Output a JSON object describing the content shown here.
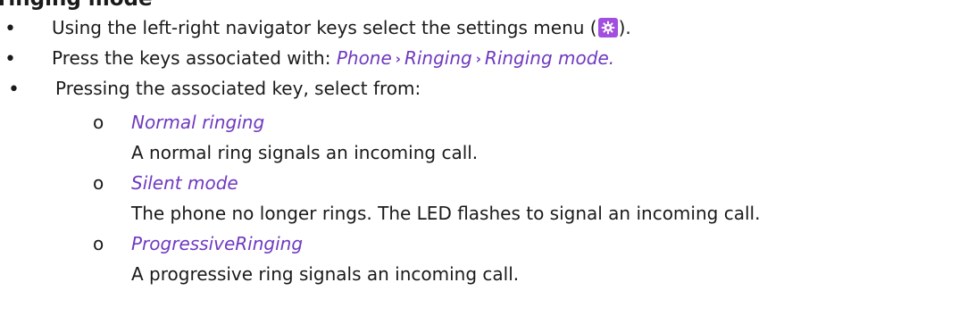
{
  "heading_fragment": "ringing mode",
  "items": [
    {
      "before": "Using the left-right navigator keys select the settings menu (",
      "icon": "settings-gear-icon",
      "after": ")."
    },
    {
      "before": "Press the keys associated with: ",
      "path": [
        "Phone",
        "Ringing",
        "Ringing mode."
      ]
    },
    {
      "text": "Pressing the associated key, select from:"
    }
  ],
  "options": [
    {
      "marker": "o",
      "title": "Normal ringing",
      "description": "A normal ring signals an incoming call."
    },
    {
      "marker": "o",
      "title": "Silent mode",
      "description": "The phone no longer rings. The LED flashes to signal an incoming call."
    },
    {
      "marker": "o",
      "title": "ProgressiveRinging",
      "description": "A progressive ring signals an incoming call."
    }
  ],
  "bullet_glyph": "•",
  "separator_glyph": "›",
  "colors": {
    "text": "#1a1a1a",
    "accent": "#6f3ac0",
    "icon_background": "#a24fe0"
  }
}
